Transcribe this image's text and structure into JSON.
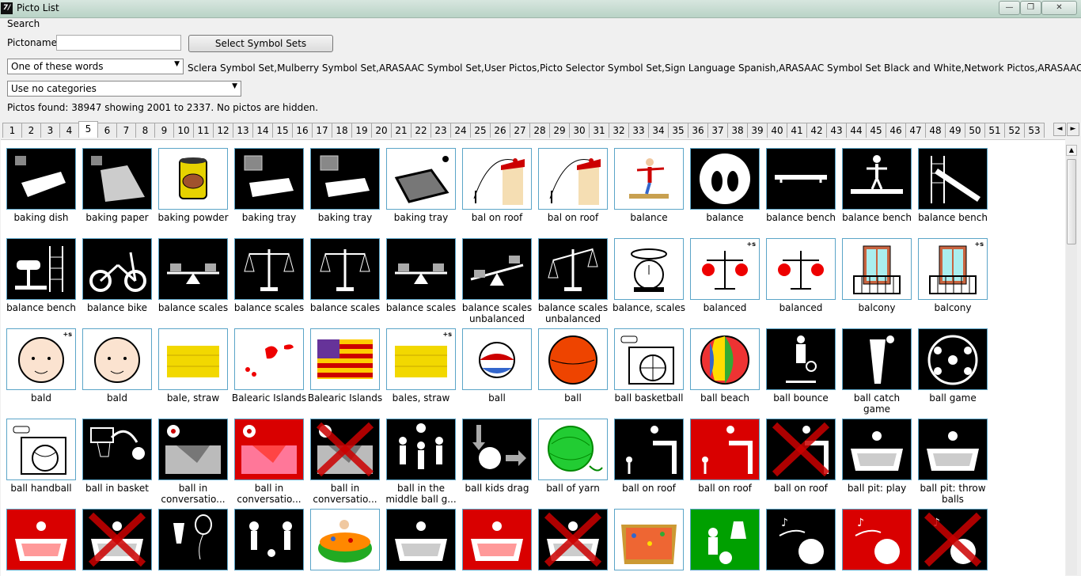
{
  "window": {
    "title": "Picto List",
    "app_icon": "7/",
    "minimize": "—",
    "maximize": "❐",
    "close": "✕"
  },
  "search": {
    "label": "Search",
    "pictoname_label": "Pictoname",
    "pictoname_value": "",
    "select_button": "Select Symbol Sets",
    "word_mode": "One of these words",
    "category_mode": "Use no categories",
    "symbol_sets": "Sclera Symbol Set,Mulberry Symbol Set,ARASAAC Symbol Set,User Pictos,Picto Selector Symbol Set,Sign Language Spanish,ARASAAC Symbol Set Black and White,Network Pictos,ARASAAC Symbol Set Dani",
    "found": "Pictos found: 38947 showing 2001 to 2337. No pictos are hidden."
  },
  "pages": [
    "1",
    "2",
    "3",
    "4",
    "5",
    "6",
    "7",
    "8",
    "9",
    "10",
    "11",
    "12",
    "13",
    "14",
    "15",
    "16",
    "17",
    "18",
    "19",
    "20",
    "21",
    "22",
    "23",
    "24",
    "25",
    "26",
    "27",
    "28",
    "29",
    "30",
    "31",
    "32",
    "33",
    "34",
    "35",
    "36",
    "37",
    "38",
    "39",
    "40",
    "41",
    "42",
    "43",
    "44",
    "45",
    "46",
    "47",
    "48",
    "49",
    "50",
    "51",
    "52",
    "53"
  ],
  "active_page": "5",
  "pictos": [
    {
      "label": "baking dish",
      "bg": "#000000",
      "icon": "dish"
    },
    {
      "label": "baking paper",
      "bg": "#000000",
      "icon": "paper"
    },
    {
      "label": "baking powder",
      "bg": "#ffffff",
      "icon": "can"
    },
    {
      "label": "baking tray",
      "bg": "#000000",
      "icon": "tray"
    },
    {
      "label": "baking tray",
      "bg": "#000000",
      "icon": "tray"
    },
    {
      "label": "baking tray",
      "bg": "#ffffff",
      "icon": "tray-color"
    },
    {
      "label": "bal on roof",
      "bg": "#ffffff",
      "icon": "roof-color"
    },
    {
      "label": "bal on roof",
      "bg": "#ffffff",
      "icon": "roof-color"
    },
    {
      "label": "balance",
      "bg": "#ffffff",
      "icon": "balance-beam"
    },
    {
      "label": "balance",
      "bg": "#000000",
      "icon": "feet-scale"
    },
    {
      "label": "balance bench",
      "bg": "#000000",
      "icon": "bench"
    },
    {
      "label": "balance bench",
      "bg": "#000000",
      "icon": "bench-person"
    },
    {
      "label": "balance bench",
      "bg": "#000000",
      "icon": "wallbars"
    },
    {
      "label": "balance bench",
      "bg": "#000000",
      "icon": "pommel"
    },
    {
      "label": "balance bike",
      "bg": "#000000",
      "icon": "bike"
    },
    {
      "label": "balance scales",
      "bg": "#000000",
      "icon": "seesaw"
    },
    {
      "label": "balance scales",
      "bg": "#000000",
      "icon": "scale"
    },
    {
      "label": "balance scales",
      "bg": "#000000",
      "icon": "scale"
    },
    {
      "label": "balance scales",
      "bg": "#000000",
      "icon": "seesaw"
    },
    {
      "label": "balance scales unbalanced",
      "bg": "#000000",
      "icon": "seesaw-tilt"
    },
    {
      "label": "balance scales unbalanced",
      "bg": "#000000",
      "icon": "scale-tilt"
    },
    {
      "label": "balance, scales",
      "bg": "#ffffff",
      "icon": "kitchen-scale"
    },
    {
      "label": "balanced",
      "bg": "#ffffff",
      "icon": "red-scale",
      "plus": "+s"
    },
    {
      "label": "balanced",
      "bg": "#ffffff",
      "icon": "red-scale"
    },
    {
      "label": "balcony",
      "bg": "#ffffff",
      "icon": "balcony"
    },
    {
      "label": "balcony",
      "bg": "#ffffff",
      "icon": "balcony",
      "plus": "+s"
    },
    {
      "label": "bald",
      "bg": "#ffffff",
      "icon": "bald-face",
      "plus": "+s"
    },
    {
      "label": "bald",
      "bg": "#ffffff",
      "icon": "bald-face"
    },
    {
      "label": "bale, straw",
      "bg": "#ffffff",
      "icon": "straw"
    },
    {
      "label": "Balearic Islands",
      "bg": "#ffffff",
      "icon": "islands"
    },
    {
      "label": "Balearic Islands",
      "bg": "#ffffff",
      "icon": "flag"
    },
    {
      "label": "bales, straw",
      "bg": "#ffffff",
      "icon": "straw",
      "plus": "+s"
    },
    {
      "label": "ball",
      "bg": "#ffffff",
      "icon": "beachball-small"
    },
    {
      "label": "ball",
      "bg": "#ffffff",
      "icon": "orange-ball"
    },
    {
      "label": "ball basketball",
      "bg": "#ffffff",
      "icon": "basketball"
    },
    {
      "label": "ball beach",
      "bg": "#ffffff",
      "icon": "beachball"
    },
    {
      "label": "ball bounce",
      "bg": "#000000",
      "icon": "bounce"
    },
    {
      "label": "ball catch game",
      "bg": "#000000",
      "icon": "catch"
    },
    {
      "label": "ball game",
      "bg": "#000000",
      "icon": "circle-game"
    },
    {
      "label": "ball handball",
      "bg": "#ffffff",
      "icon": "handball"
    },
    {
      "label": "ball in basket",
      "bg": "#000000",
      "icon": "hoop"
    },
    {
      "label": "ball in conversatio...",
      "bg": "#000000",
      "icon": "pit-grey"
    },
    {
      "label": "ball in conversatio...",
      "bg": "#d90000",
      "icon": "pit-red"
    },
    {
      "label": "ball in conversatio...",
      "bg": "#000000",
      "icon": "pit-cross"
    },
    {
      "label": "ball in the middle ball g...",
      "bg": "#000000",
      "icon": "middle"
    },
    {
      "label": "ball kids drag",
      "bg": "#000000",
      "icon": "drag"
    },
    {
      "label": "ball of yarn",
      "bg": "#ffffff",
      "icon": "yarn"
    },
    {
      "label": "ball on roof",
      "bg": "#000000",
      "icon": "roof-bw"
    },
    {
      "label": "ball on roof",
      "bg": "#d90000",
      "icon": "roof-red"
    },
    {
      "label": "ball on roof",
      "bg": "#000000",
      "icon": "roof-cross"
    },
    {
      "label": "ball pit: play",
      "bg": "#000000",
      "icon": "ballpit"
    },
    {
      "label": "ball pit: throw balls",
      "bg": "#000000",
      "icon": "ballpit"
    },
    {
      "label": "",
      "bg": "#d90000",
      "icon": "ballpit-red"
    },
    {
      "label": "",
      "bg": "#000000",
      "icon": "ballpit-cross"
    },
    {
      "label": "",
      "bg": "#000000",
      "icon": "balloon"
    },
    {
      "label": "",
      "bg": "#000000",
      "icon": "kick"
    },
    {
      "label": "",
      "bg": "#ffffff",
      "icon": "pool-color"
    },
    {
      "label": "",
      "bg": "#000000",
      "icon": "ballpit"
    },
    {
      "label": "",
      "bg": "#d90000",
      "icon": "ballpit-red"
    },
    {
      "label": "",
      "bg": "#000000",
      "icon": "ballpit-cross"
    },
    {
      "label": "",
      "bg": "#ffffff",
      "icon": "pool-color2"
    },
    {
      "label": "",
      "bg": "#00a000",
      "icon": "bell"
    },
    {
      "label": "",
      "bg": "#000000",
      "icon": "music-ball"
    },
    {
      "label": "",
      "bg": "#d90000",
      "icon": "music-ball-red"
    },
    {
      "label": "",
      "bg": "#000000",
      "icon": "music-ball-cross"
    }
  ]
}
